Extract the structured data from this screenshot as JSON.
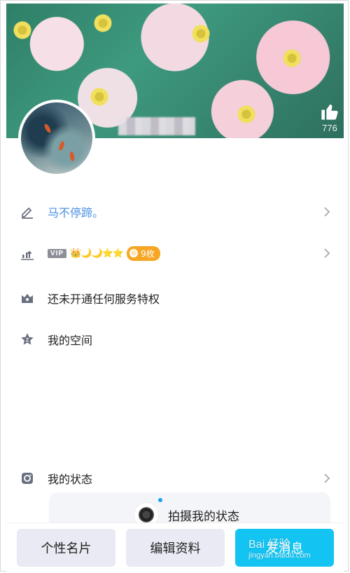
{
  "profile": {
    "like_count": "776"
  },
  "menu": {
    "signature": "马不停蹄。",
    "level": {
      "vip_tag": "VIP",
      "level_glyphs": "👑🌙🌙⭐⭐",
      "coin_label": "9枚"
    },
    "service_label": "还未开通任何服务特权",
    "space_label": "我的空间",
    "status_label": "我的状态"
  },
  "status_card": {
    "capture_label": "拍摄我的状态"
  },
  "bottom_bar": {
    "card_button": "个性名片",
    "edit_button": "编辑资料",
    "send_button": "发消息"
  },
  "watermark": {
    "brand": "Bai 经验",
    "url": "jingyan.baidu.com"
  },
  "colors": {
    "accent_blue": "#13c3f1",
    "link_blue": "#4a90e2",
    "coin_orange": "#f6a623"
  }
}
